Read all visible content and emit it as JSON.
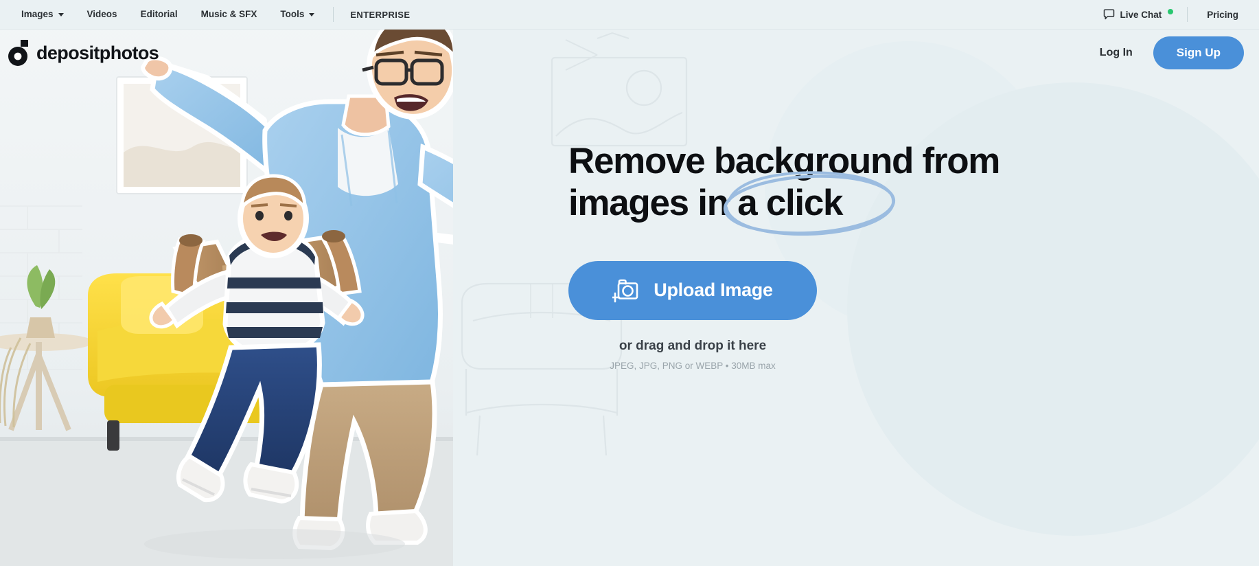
{
  "topnav": {
    "items": [
      {
        "label": "Images",
        "has_caret": true
      },
      {
        "label": "Videos",
        "has_caret": false
      },
      {
        "label": "Editorial",
        "has_caret": false
      },
      {
        "label": "Music & SFX",
        "has_caret": false
      },
      {
        "label": "Tools",
        "has_caret": true
      }
    ],
    "enterprise_label": "ENTERPRISE",
    "live_chat_label": "Live Chat",
    "live_chat_status_color": "#28c76f",
    "pricing_label": "Pricing"
  },
  "header": {
    "logo_text": "depositphotos",
    "login_label": "Log In",
    "signup_label": "Sign Up",
    "accent_color": "#4a90d9"
  },
  "hero": {
    "headline_line1": "Remove background from",
    "headline_line2_prefix": "images in",
    "headline_line2_highlight": "a click",
    "highlight_circle_color": "#9bbce0",
    "upload_button_label": "Upload Image",
    "upload_button_color": "#4a90d9",
    "upload_icon": "camera-plus-icon",
    "drag_text": "or drag and drop it here",
    "formats_text": "JPEG, JPG, PNG or WEBP • 30MB max"
  },
  "colors": {
    "page_background": "#eaf1f3",
    "text_primary": "#2b3034",
    "text_muted": "#9aa5ab"
  }
}
